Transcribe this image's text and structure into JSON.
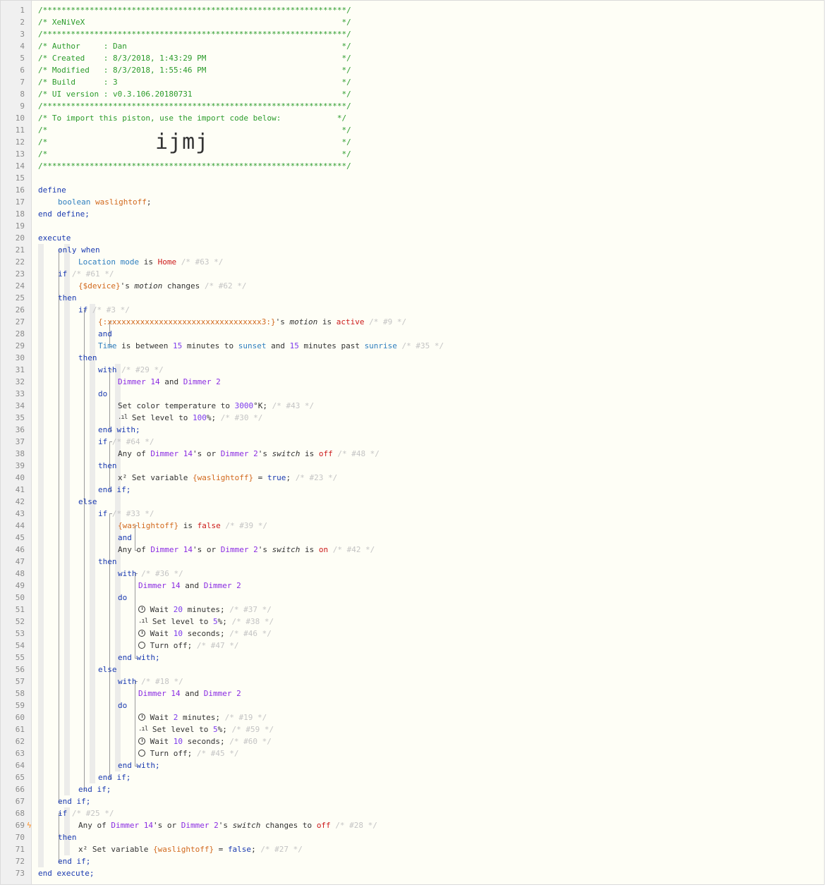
{
  "editor": {
    "import_code": "ijmj",
    "flash_marker_line": 69,
    "lines": [
      "/*****************************************************************/",
      "/* XeNiVeX                                                       */",
      "/*****************************************************************/",
      "/* Author     : Dan                                              */",
      "/* Created    : 8/3/2018, 1:43:29 PM                             */",
      "/* Modified   : 8/3/2018, 1:55:46 PM                             */",
      "/* Build      : 3                                                */",
      "/* UI version : v0.3.106.20180731                                */",
      "/*****************************************************************/",
      "/* To import this piston, use the import code below:            */",
      "/*                                                               */",
      "/*                                                               */",
      "/*                                                               */",
      "/*****************************************************************/",
      "",
      "define",
      "    boolean waslightoff;",
      "end define;",
      "",
      "execute",
      "    only when",
      "        Location mode is Home /* #63 */",
      "    if /* #61 */",
      "        {$device}'s motion changes /* #62 */",
      "    then",
      "        if /* #3 */",
      "            {:xxxxxxxxxxxxxxxxxxxxxxxxxxxxxxxxx3:}'s motion is active /* #9 */",
      "            and",
      "            Time is between 15 minutes to sunset and 15 minutes past sunrise /* #35 */",
      "        then",
      "            with /* #29 */",
      "                Dimmer 14 and Dimmer 2",
      "            do",
      "                Set color temperature to 3000°K; /* #43 */",
      "                Set level to 100%; /* #30 */",
      "            end with;",
      "            if /* #64 */",
      "                Any of Dimmer 14's or Dimmer 2's switch is off /* #48 */",
      "            then",
      "                x² Set variable {waslightoff} = true; /* #23 */",
      "            end if;",
      "        else",
      "            if /* #33 */",
      "                {waslightoff} is false /* #39 */",
      "                and",
      "                Any of Dimmer 14's or Dimmer 2's switch is on /* #42 */",
      "            then",
      "                with /* #36 */",
      "                    Dimmer 14 and Dimmer 2",
      "                do",
      "                    Wait 20 minutes; /* #37 */",
      "                    Set level to 5%; /* #38 */",
      "                    Wait 10 seconds; /* #46 */",
      "                    Turn off; /* #47 */",
      "                end with;",
      "            else",
      "                with /* #18 */",
      "                    Dimmer 14 and Dimmer 2",
      "                do",
      "                    Wait 2 minutes; /* #19 */",
      "                    Set level to 5%; /* #59 */",
      "                    Wait 10 seconds; /* #60 */",
      "                    Turn off; /* #45 */",
      "                end with;",
      "            end if;",
      "        end if;",
      "    end if;",
      "    if /* #25 */",
      "        Any of Dimmer 14's or Dimmer 2's switch changes to off /* #28 */",
      "    then",
      "        x² Set variable {waslightoff} = false; /* #27 */",
      "    end if;",
      "end execute;"
    ]
  },
  "icons": {
    "flash": "lightning-icon",
    "wait": "clock-icon",
    "level": "signal-bars-icon",
    "turn_off": "power-icon",
    "variable": "superscript-x-icon"
  },
  "colors": {
    "comment": "#2b9b2b",
    "keyword": "#1a3ab0",
    "variable": "#d2691e",
    "device": "#8a2be2",
    "value": "#cc1a1a",
    "number": "#7c3aed"
  }
}
